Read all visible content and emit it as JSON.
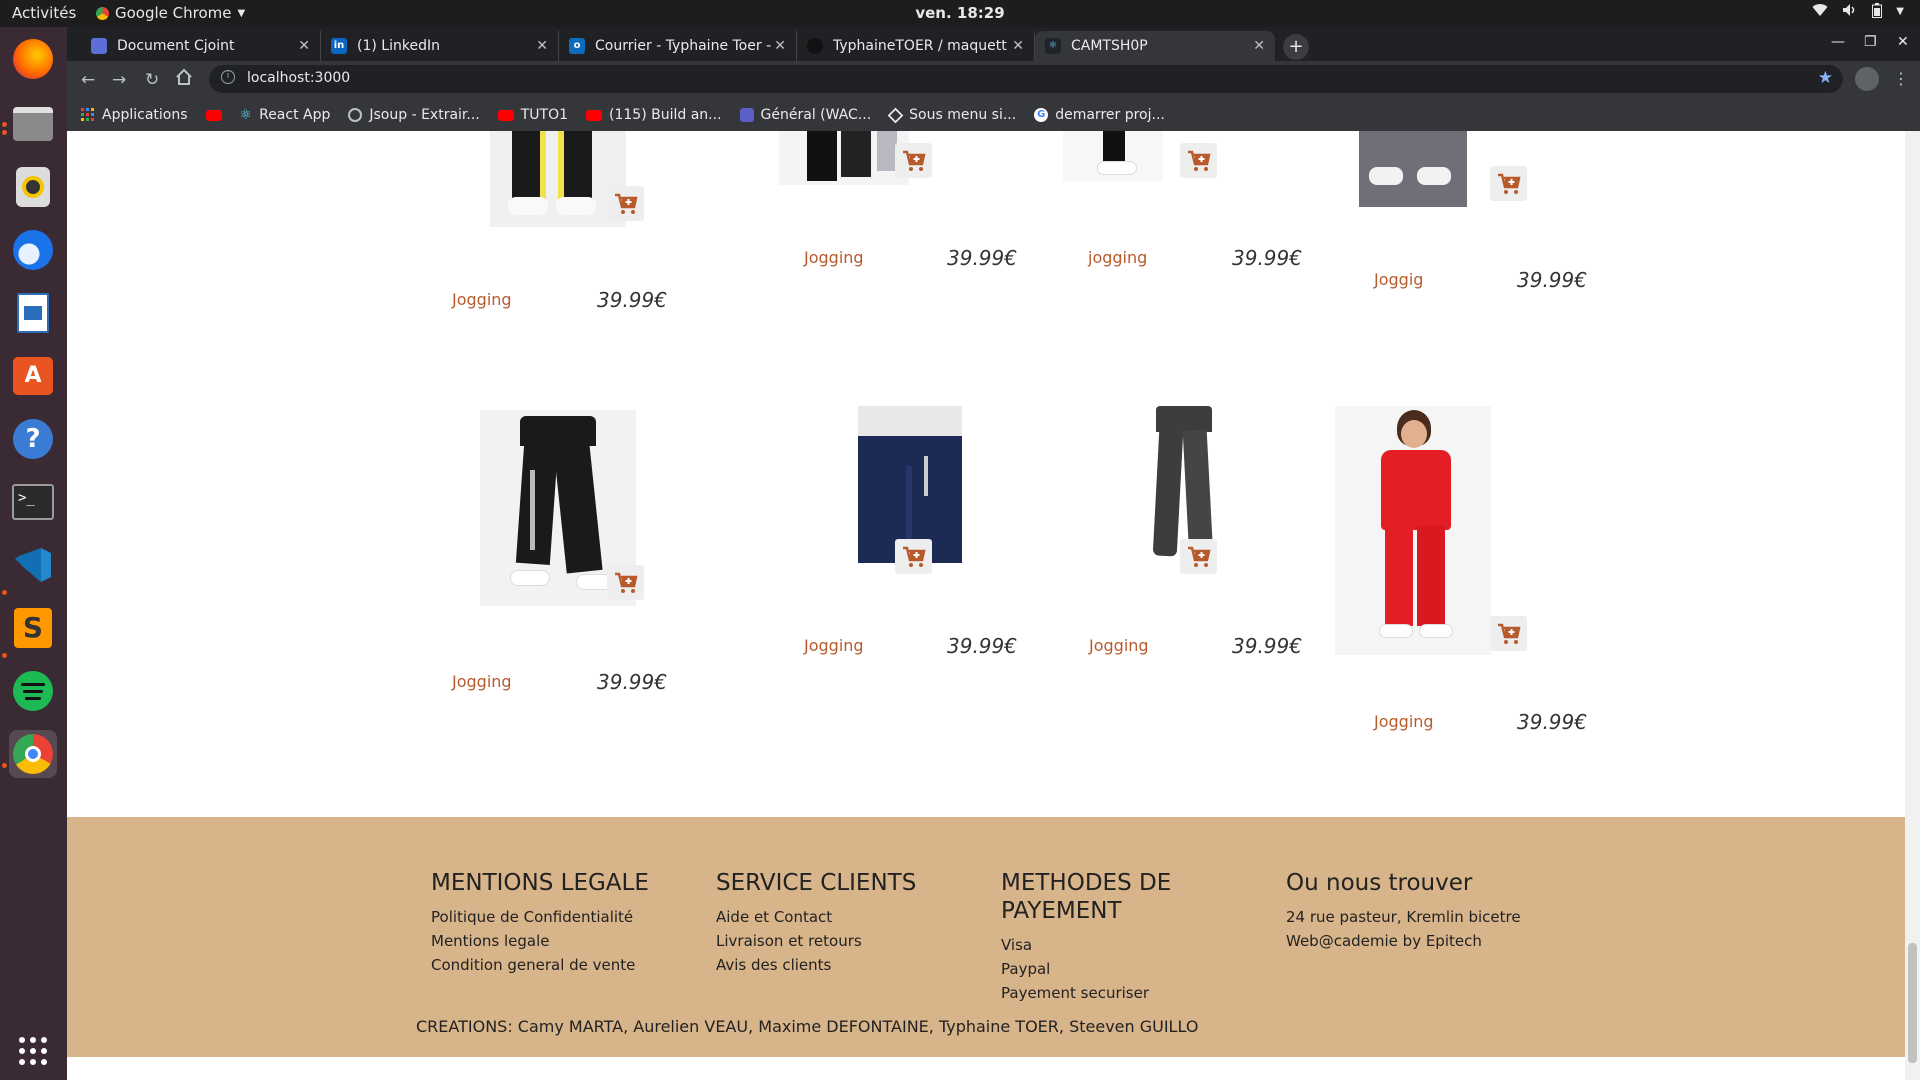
{
  "topbar": {
    "activities": "Activités",
    "app": "Google Chrome",
    "clock": "ven. 18:29"
  },
  "dock": {
    "items": [
      "firefox",
      "files",
      "rhythmbox",
      "thunderbird",
      "libreoffice-writer",
      "software-center",
      "help",
      "terminal",
      "vscode",
      "sublime-text",
      "spotify",
      "chrome"
    ],
    "show_apps": "show-applications"
  },
  "tabs": [
    {
      "label": "Document Cjoint",
      "icon": "document-favicon",
      "color": "#5b6fd6"
    },
    {
      "label": "(1) LinkedIn",
      "icon": "linkedin-favicon",
      "color": "#0a66c2"
    },
    {
      "label": "Courrier - Typhaine Toer -",
      "icon": "outlook-favicon",
      "color": "#0f6cbd"
    },
    {
      "label": "TyphaineTOER / maquett",
      "icon": "github-favicon",
      "color": "#111111"
    },
    {
      "label": "CAMTSH0P",
      "icon": "react-favicon",
      "color": "#61dafb"
    }
  ],
  "omnibox": {
    "url": "localhost:3000"
  },
  "bookmarks": [
    {
      "label": "Applications",
      "icon": "apps-grid-icon"
    },
    {
      "label": "",
      "icon": "youtube-icon"
    },
    {
      "label": "React App",
      "icon": "react-icon"
    },
    {
      "label": "Jsoup - Extrair...",
      "icon": "globe-icon"
    },
    {
      "label": "TUTO1",
      "icon": "youtube-icon"
    },
    {
      "label": "(115) Build an...",
      "icon": "youtube-icon"
    },
    {
      "label": "Général (WAC...",
      "icon": "teams-icon"
    },
    {
      "label": "Sous menu si...",
      "icon": "codepen-icon"
    },
    {
      "label": "demarrer proj...",
      "icon": "google-icon"
    }
  ],
  "products": [
    {
      "name": "Jogging",
      "price": "39.99€",
      "color": "#2a2a2a"
    },
    {
      "name": "Jogging",
      "price": "39.99€",
      "color": "#1c1c1c"
    },
    {
      "name": "jogging",
      "price": "39.99€",
      "color": "#202020"
    },
    {
      "name": "Joggig",
      "price": "39.99€",
      "color": "#6f6f78"
    },
    {
      "name": "Jogging",
      "price": "39.99€",
      "color": "#1a1a1a"
    },
    {
      "name": "Jogging",
      "price": "39.99€",
      "color": "#1d2a55"
    },
    {
      "name": "Jogging",
      "price": "39.99€",
      "color": "#3d3d3d"
    },
    {
      "name": "Jogging",
      "price": "39.99€",
      "color": "#e31e24"
    }
  ],
  "footer": {
    "columns": [
      {
        "title": "MENTIONS LEGALE",
        "links": [
          "Politique de Confidentialité",
          "Mentions legale",
          "Condition general de vente"
        ]
      },
      {
        "title": "SERVICE CLIENTS",
        "links": [
          "Aide et Contact",
          "Livraison et retours",
          "Avis des clients"
        ]
      },
      {
        "title": "METHODES DE PAYEMENT",
        "links": [
          "Visa",
          "Paypal",
          "Payement securiser"
        ]
      },
      {
        "title": "Ou nous trouver",
        "links": [
          "24 rue pasteur, Kremlin bicetre",
          "Web@cademie by Epitech"
        ]
      }
    ],
    "credits": "CREATIONS: Camy MARTA, Aurelien VEAU, Maxime DEFONTAINE, Typhaine TOER, Steeven GUILLO"
  },
  "colors": {
    "accent": "#b85b2c",
    "footer_bg": "#d8b48a"
  }
}
